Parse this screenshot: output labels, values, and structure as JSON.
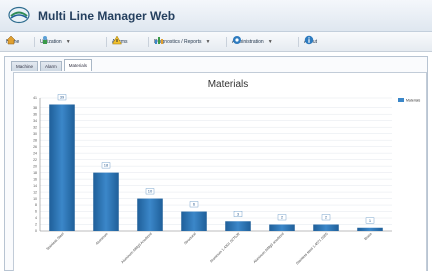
{
  "app": {
    "title": "Multi Line Manager Web"
  },
  "menu": {
    "items": [
      {
        "label": "Home",
        "icon": "home-icon",
        "dropdown": false
      },
      {
        "label": "Utilization",
        "icon": "utilization-icon",
        "dropdown": true
      },
      {
        "label": "Alarms",
        "icon": "alarm-icon",
        "dropdown": false
      },
      {
        "label": "Diagnostics / Reports",
        "icon": "diagnostics-icon",
        "dropdown": true
      },
      {
        "label": "Administration",
        "icon": "administration-icon",
        "dropdown": true
      },
      {
        "label": "About",
        "icon": "about-icon",
        "dropdown": false
      }
    ]
  },
  "tabs": [
    "Machine",
    "Alarm",
    "Materials"
  ],
  "active_tab": "Materials",
  "colors": {
    "bar": "#3b87c9",
    "bar_dark": "#1f5f99",
    "accent": "#2a5b8f"
  },
  "chart_data": {
    "type": "bar",
    "title": "Materials",
    "categories": [
      "Stainless Steel",
      "Aluminum",
      "Aluminum AlMg3 Anodized",
      "Structural",
      "Aluminum 1.4301 S275JR",
      "Aluminum AlMg3 anodized",
      "Stainless steel 1.4571 S355",
      "Brass"
    ],
    "values": [
      39,
      18,
      10,
      6,
      3,
      2,
      2,
      1
    ],
    "ylim": [
      0,
      41
    ],
    "yticks": [
      0,
      2,
      4,
      6,
      8,
      10,
      12,
      14,
      16,
      18,
      20,
      22,
      24,
      26,
      28,
      30,
      32,
      34,
      36,
      38,
      41
    ],
    "grid": true,
    "legend": {
      "position": "top-right",
      "entries": [
        "Materials"
      ]
    }
  }
}
